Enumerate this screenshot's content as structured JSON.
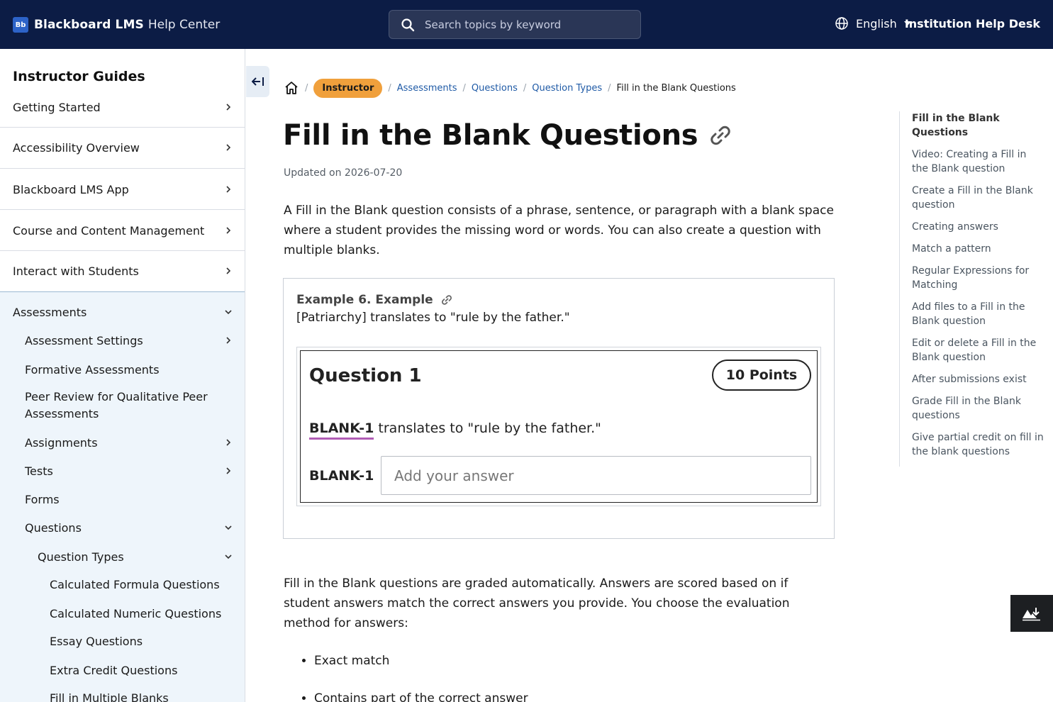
{
  "header": {
    "logo_text": "Bb",
    "brand_name": "Blackboard LMS",
    "brand_sub": "Help Center",
    "search_placeholder": "Search topics by keyword",
    "language": "English",
    "help_desk": "Institution Help Desk"
  },
  "sidebar": {
    "title": "Instructor Guides",
    "top_items": [
      {
        "label": "Getting Started"
      },
      {
        "label": "Accessibility Overview"
      },
      {
        "label": "Blackboard LMS App"
      },
      {
        "label": "Course and Content Management"
      },
      {
        "label": "Interact with Students"
      }
    ],
    "assessments": {
      "label": "Assessments",
      "children": [
        {
          "label": "Assessment Settings"
        },
        {
          "label": "Formative Assessments"
        },
        {
          "label": "Peer Review for Qualitative Peer Assessments"
        },
        {
          "label": "Assignments"
        },
        {
          "label": "Tests"
        },
        {
          "label": "Forms"
        },
        {
          "label": "Questions"
        }
      ],
      "question_types": {
        "label": "Question Types",
        "children": [
          {
            "label": "Calculated Formula Questions"
          },
          {
            "label": "Calculated Numeric Questions"
          },
          {
            "label": "Essay Questions"
          },
          {
            "label": "Extra Credit Questions"
          },
          {
            "label": "Fill in Multiple Blanks"
          }
        ]
      }
    }
  },
  "breadcrumb": {
    "badge": "Instructor",
    "links": [
      "Assessments",
      "Questions",
      "Question Types"
    ],
    "current": "Fill in the Blank Questions"
  },
  "article": {
    "title": "Fill in the Blank Questions",
    "updated": "Updated on 2026-07-20",
    "intro": "A Fill in the Blank question consists of a phrase, sentence, or paragraph with a blank space where a student provides the missing word or words. You can also create a question with multiple blanks.",
    "example": {
      "title": "Example 6. Example",
      "text": "[Patriarchy] translates to \"rule by the father.\"",
      "question_title": "Question 1",
      "points": "10 Points",
      "blank_token": "BLANK-1",
      "statement_rest": " translates to \"rule by the father.\"",
      "blank_label": "BLANK-1",
      "answer_placeholder": "Add your answer"
    },
    "graded_para": "Fill in the Blank questions are graded automatically. Answers are scored based on if student answers match the correct answers you provide. You choose the evaluation method for answers:",
    "methods": [
      "Exact match",
      "Contains part of the correct answer"
    ]
  },
  "toc": {
    "items": [
      "Fill in the Blank Questions",
      "Video: Creating a Fill in the Blank question",
      "Create a Fill in the Blank question",
      "Creating answers",
      "Match a pattern",
      "Regular Expressions for Matching",
      "Add files to a Fill in the Blank question",
      "Edit or delete a Fill in the Blank question",
      "After submissions exist",
      "Grade Fill in the Blank questions",
      "Give partial credit on fill in the blank questions"
    ]
  },
  "colors": {
    "header_bg": "#0c1c45",
    "badge": "#f0a03c",
    "link": "#1f5aa6",
    "subnav_bg": "#eef5fb"
  }
}
